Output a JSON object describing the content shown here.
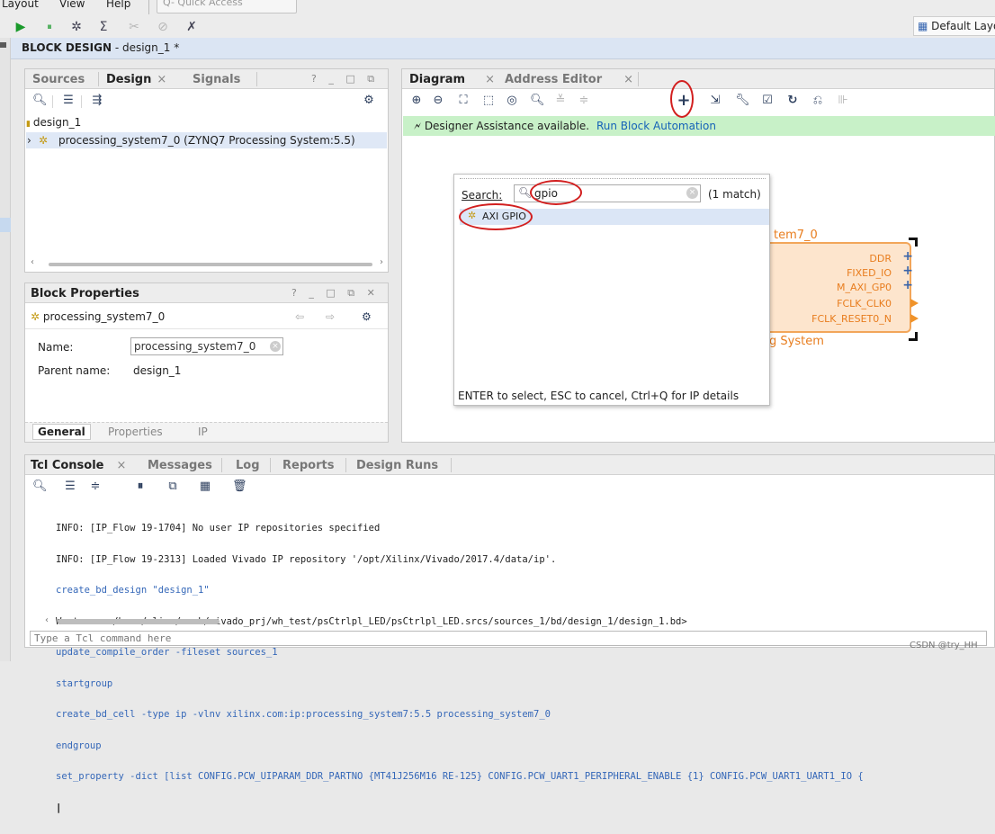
{
  "menu": {
    "items": [
      "Layout",
      "View",
      "Help"
    ],
    "quick_access_placeholder": "Q- Quick Access"
  },
  "toolbar": {
    "icons": [
      "run-icon",
      "debug-icon",
      "settings-icon",
      "sigma-icon",
      "cut-icon",
      "slash-icon",
      "tool-icon"
    ],
    "default_layout": "Default Layout"
  },
  "block_design": {
    "title": "BLOCK DESIGN",
    "subtitle": " - design_1 *"
  },
  "sources_panel": {
    "tabs": [
      {
        "label": "Sources",
        "active": false
      },
      {
        "label": "Design",
        "active": true
      },
      {
        "label": "Signals",
        "active": false
      }
    ],
    "tools": "? _ □ ⧉",
    "tree": {
      "root": "design_1",
      "child": "processing_system7_0 (ZYNQ7 Processing System:5.5)"
    }
  },
  "block_properties": {
    "title": "Block Properties",
    "tools": "? _ □ ⧉ ✕",
    "selected": "processing_system7_0",
    "name_label": "Name:",
    "name_value": "processing_system7_0",
    "parent_label": "Parent name:",
    "parent_value": "design_1",
    "bottom_tabs": [
      "General",
      "Properties",
      "IP"
    ]
  },
  "diagram_panel": {
    "tabs": [
      {
        "label": "Diagram",
        "active": true
      },
      {
        "label": "Address Editor",
        "active": false
      }
    ],
    "assist_text": "Designer Assistance available.",
    "assist_link": "Run Block Automation",
    "ps_block": {
      "title_fragment": "tem7_0",
      "subtitle_fragment": "g System",
      "ports": [
        "DDR",
        "FIXED_IO",
        "M_AXI_GP0",
        "FCLK_CLK0",
        "FCLK_RESET0_N"
      ]
    }
  },
  "ip_search": {
    "label": "Search:",
    "query": "gpio",
    "match_count": "(1 match)",
    "results": [
      "AXI GPIO"
    ],
    "hint": "ENTER to select, ESC to cancel, Ctrl+Q for IP details"
  },
  "tcl_console": {
    "tabs": [
      {
        "label": "Tcl Console",
        "active": true
      },
      {
        "label": "Messages",
        "active": false
      },
      {
        "label": "Log",
        "active": false
      },
      {
        "label": "Reports",
        "active": false
      },
      {
        "label": "Design Runs",
        "active": false
      }
    ],
    "lines": [
      {
        "kind": "info",
        "text": "INFO: [IP_Flow 19-1704] No user IP repositories specified"
      },
      {
        "kind": "info",
        "text": "INFO: [IP_Flow 19-2313] Loaded Vivado IP repository '/opt/Xilinx/Vivado/2017.4/data/ip'."
      },
      {
        "kind": "cmd",
        "text": "create_bd_design \"design_1\""
      },
      {
        "kind": "info",
        "text": "Wrote  : </home/alinx/work/vivado_prj/wh_test/psCtrlpl_LED/psCtrlpl_LED.srcs/sources_1/bd/design_1/design_1.bd>"
      },
      {
        "kind": "cmd",
        "text": "update_compile_order -fileset sources_1"
      },
      {
        "kind": "cmd",
        "text": "startgroup"
      },
      {
        "kind": "cmd",
        "text": "create_bd_cell -type ip -vlnv xilinx.com:ip:processing_system7:5.5 processing_system7_0"
      },
      {
        "kind": "cmd",
        "text": "endgroup"
      },
      {
        "kind": "cmd",
        "text": "set_property -dict [list CONFIG.PCW_UIPARAM_DDR_PARTNO {MT41J256M16 RE-125} CONFIG.PCW_UART1_PERIPHERAL_ENABLE {1} CONFIG.PCW_UART1_UART1_IO {"
      }
    ],
    "input_placeholder": "Type a Tcl command here"
  },
  "watermark": "CSDN @try_HH",
  "colors": {
    "accent_blue": "#1562b8",
    "assist_green": "#c8f1c8",
    "ps_orange": "#e87d1e",
    "annotation_red": "#d21f1f"
  }
}
